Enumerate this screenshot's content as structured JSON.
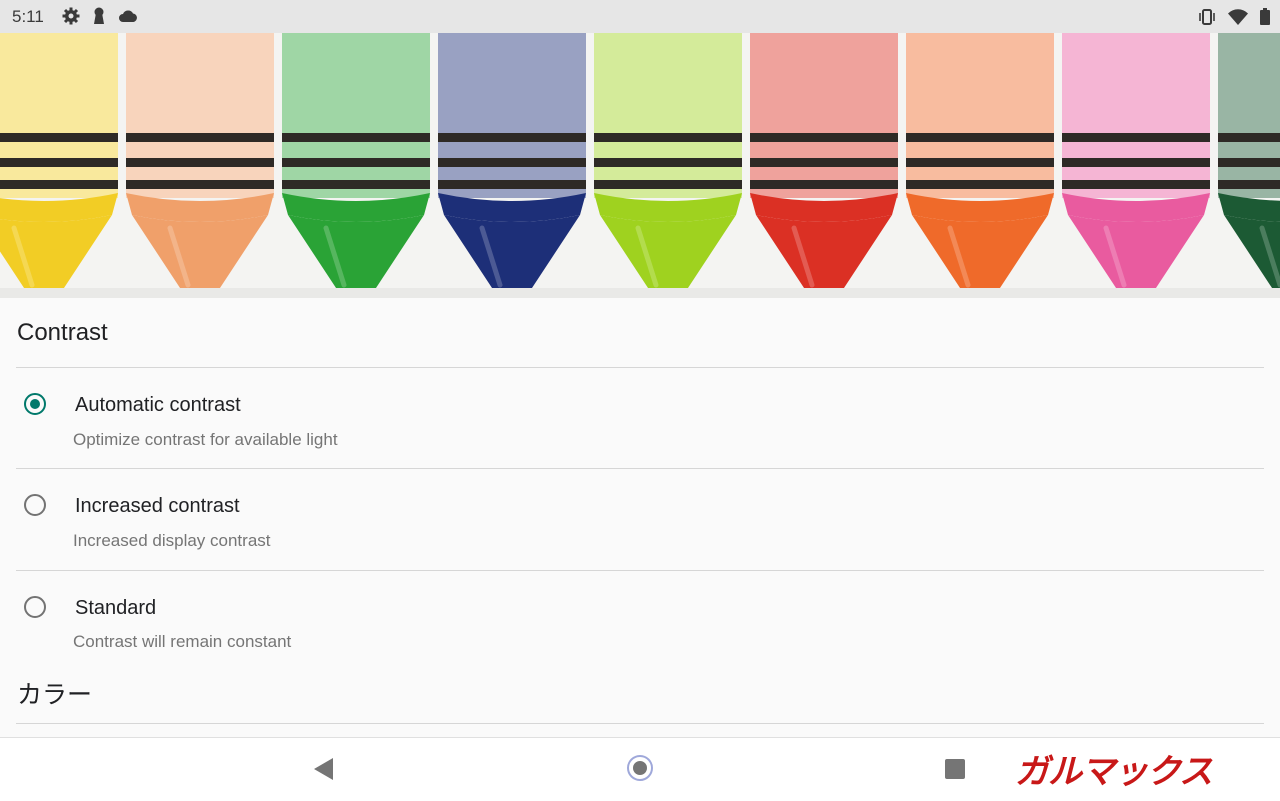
{
  "status_bar": {
    "time": "5:11",
    "left_icons": [
      "settings-gear-icon",
      "keyhole-icon",
      "cloud-icon"
    ],
    "right_icons": [
      "vibrate-icon",
      "wifi-icon",
      "battery-icon"
    ]
  },
  "banner": {
    "description_icon": "crayons-banner-image",
    "colors": [
      "#f2cd25",
      "#f0a06a",
      "#2aa336",
      "#1d2f78",
      "#9fd21f",
      "#db3024",
      "#ef6a2a",
      "#e95b9f",
      "#1c5a34"
    ]
  },
  "contrast": {
    "section_title": "Contrast",
    "options": [
      {
        "title": "Automatic contrast",
        "subtitle": "Optimize contrast for available light",
        "selected": true
      },
      {
        "title": "Increased contrast",
        "subtitle": "Increased display contrast",
        "selected": false
      },
      {
        "title": "Standard",
        "subtitle": "Contrast will remain constant",
        "selected": false
      }
    ]
  },
  "color_section": {
    "title": "カラー"
  },
  "nav_bar": {
    "buttons": [
      "back-icon",
      "home-icon",
      "recents-icon"
    ]
  },
  "watermark": {
    "text": "ガルマックス"
  },
  "accent_color": "#00796b"
}
